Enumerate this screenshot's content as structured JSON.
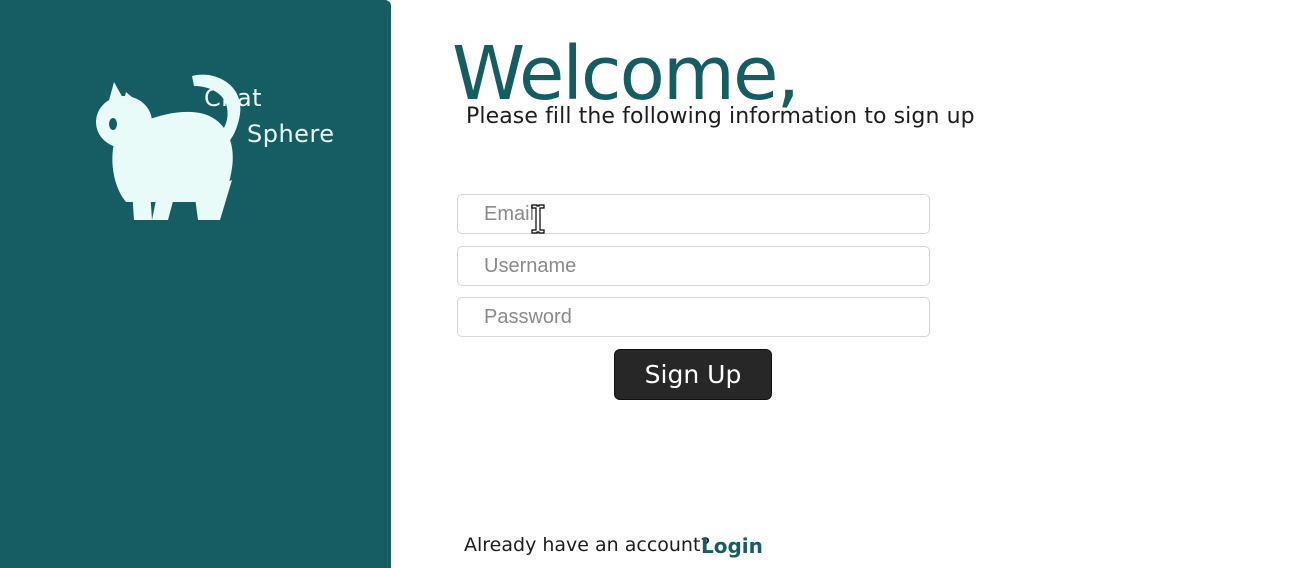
{
  "colors": {
    "sidebar_bg": "#165c63",
    "accent": "#165c63",
    "logo_fg": "#e8fbf8",
    "button_bg": "#272727",
    "button_text": "#ffffff"
  },
  "sidebar": {
    "logo": {
      "icon": "cat-icon",
      "line1": "Chat",
      "line2": "Sphere"
    }
  },
  "main": {
    "welcome": "Welcome,",
    "subtitle": "Please fill the following information to sign up",
    "fields": {
      "email": {
        "placeholder": "Email",
        "value": ""
      },
      "username": {
        "placeholder": "Username",
        "value": ""
      },
      "password": {
        "placeholder": "Password",
        "value": ""
      }
    },
    "signup_label": "Sign Up",
    "login_prompt": "Already have an account?",
    "login_label": "Login"
  },
  "cursor": {
    "icon": "text-cursor-icon"
  }
}
